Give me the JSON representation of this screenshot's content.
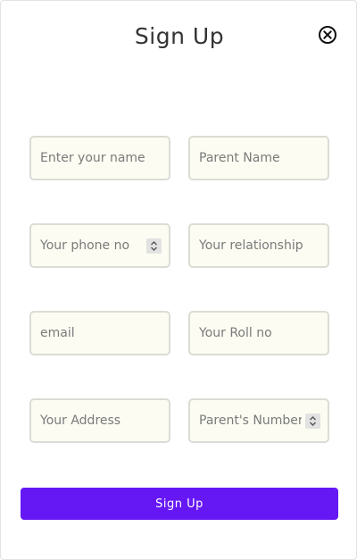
{
  "dialog": {
    "title": "Sign Up",
    "close_icon": "close-circle-icon"
  },
  "form": {
    "fields": [
      {
        "placeholder": "Enter your name",
        "value": "",
        "type": "text"
      },
      {
        "placeholder": "Parent Name",
        "value": "",
        "type": "text"
      },
      {
        "placeholder": "Your phone no",
        "value": "",
        "type": "number"
      },
      {
        "placeholder": "Your relationship",
        "value": "",
        "type": "text"
      },
      {
        "placeholder": "email",
        "value": "",
        "type": "email"
      },
      {
        "placeholder": "Your Roll no",
        "value": "",
        "type": "text"
      },
      {
        "placeholder": "Your Address",
        "value": "",
        "type": "text"
      },
      {
        "placeholder": "Parent's Number",
        "value": "",
        "type": "number"
      }
    ],
    "submit_label": "Sign Up"
  },
  "colors": {
    "accent": "#6518f4",
    "field_background": "#fcfcf2",
    "field_border": "#dcdcd6"
  }
}
